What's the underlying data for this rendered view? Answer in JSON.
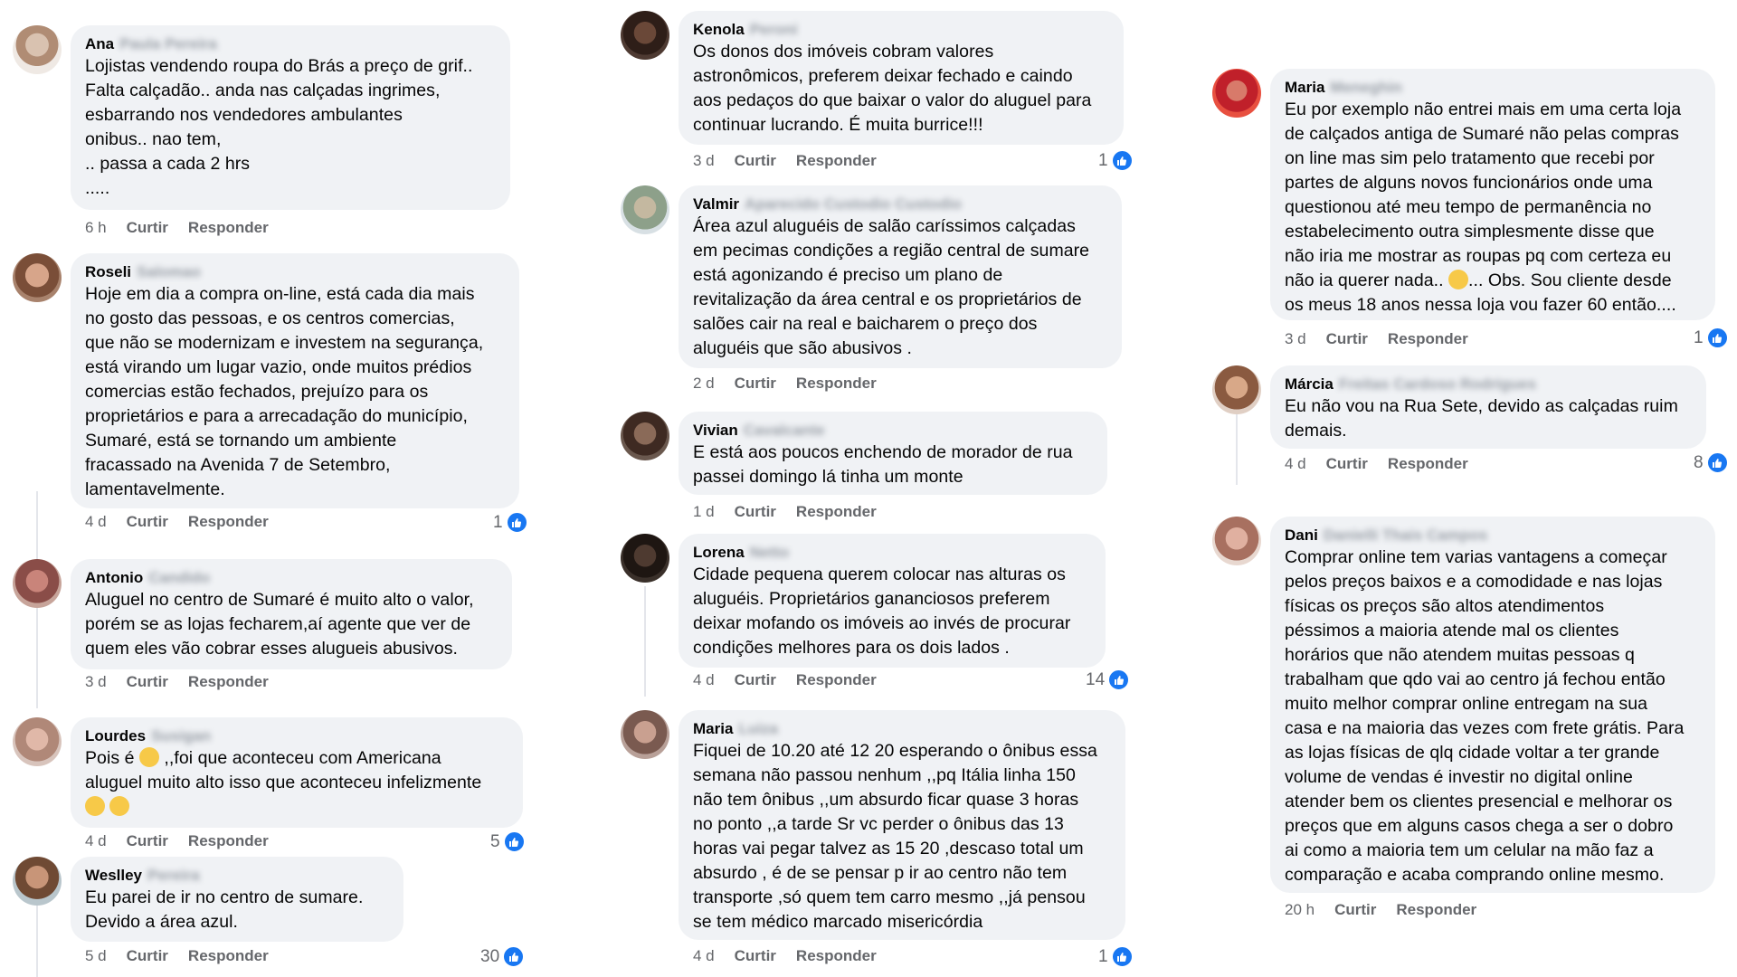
{
  "actions": {
    "like": "Curtir",
    "reply": "Responder"
  },
  "colors": {
    "like_badge": "#1877f2",
    "bubble": "#f0f2f5",
    "meta": "#65676b"
  },
  "columns": [
    [
      {
        "first": "Ana",
        "surname": "Paula Pereira",
        "text": "Lojistas vendendo roupa do Brás a preço de grif..\nFalta calçadão.. anda nas calçadas ingrimes,\nesbarrando nos vendedores ambulantes\nonibus.. nao tem,\n.. passa a cada 2 hrs\n.....",
        "time": "6 h",
        "likes": ""
      },
      {
        "first": "Roseli",
        "surname": "Salomao",
        "text": "Hoje em dia a compra on-line,  está cada dia mais\nno gosto das pessoas, e os centros comercias,\nque não se modernizam e investem na segurança,\nestá virando um lugar vazio, onde muitos prédios\ncomercias estão fechados, prejuízo para os\nproprietários e para a arrecadação do município,\nSumaré,  está se tornando um ambiente\nfracassado na Avenida 7 de Setembro,\nlamentavelmente.",
        "time": "4 d",
        "likes": "1"
      },
      {
        "first": "Antonio",
        "surname": "Candido",
        "text": "Aluguel no centro de Sumaré é muito alto o valor,\nporém se as lojas fecharem,aí agente que ver de\nquem eles vão cobrar esses alugueis abusivos.",
        "time": "3 d",
        "likes": ""
      },
      {
        "first": "Lourdes",
        "surname": "Susigan",
        "text_a": "Pois é ",
        "text_b": " ,,foi que aconteceu com Americana\naluguel muito alto isso que aconteceu infelizmente\n",
        "time": "4 d",
        "likes": "5"
      },
      {
        "first": "Weslley",
        "surname": "Pereira",
        "text": "Eu parei de ir no centro de sumare.\nDevido a área azul.",
        "time": "5 d",
        "likes": "30"
      }
    ],
    [
      {
        "first": "Kenola",
        "surname": "Peroni",
        "text": "Os donos dos imóveis cobram valores\nastronômicos, preferem deixar fechado e caindo\naos pedaços do que baixar o valor do aluguel para\ncontinuar lucrando. É muita burrice!!!",
        "time": "3 d",
        "likes": "1"
      },
      {
        "first": "Valmir",
        "surname": "Aparecido Custodio Custodio",
        "text": "Área azul aluguéis de salão caríssimos calçadas\nem pecimas condições a região central de sumare\nestá agonizando é preciso um plano de\nrevitalização da área central e os proprietários de\nsalões cair na real e baicharem o preço dos\naluguéis que são abusivos .",
        "time": "2 d",
        "likes": ""
      },
      {
        "first": "Vivian",
        "surname": "Cavalcante",
        "text": "E está aos poucos enchendo de morador de rua\npassei domingo lá tinha um monte",
        "time": "1 d",
        "likes": ""
      },
      {
        "first": "Lorena",
        "surname": "Netto",
        "text": "Cidade pequena querem colocar nas alturas os\naluguéis. Proprietários gananciosos preferem\ndeixar mofando os imóveis ao invés de procurar\ncondições melhores para os dois lados .",
        "time": "4 d",
        "likes": "14"
      },
      {
        "first": "Maria",
        "surname": "Luiza",
        "text": "Fiquei de 10.20 até 12 20 esperando o ônibus essa\nsemana não passou nenhum ,,pq Itália linha 150\nnão tem ônibus ,,um absurdo ficar quase 3 horas\nno ponto ,,a tarde Sr vc perder o ônibus das 13\nhoras vai pegar talvez as 15 20 ,descaso total um\nabsurdo , é de se pensar p ir ao centro não tem\ntransporte ,só quem tem carro mesmo ,,já pensou\nse tem médico marcado misericórdia",
        "time": "4 d",
        "likes": "1"
      }
    ],
    [
      {
        "first": "Maria",
        "surname": "Meneghin",
        "text_a": "Eu por exemplo não entrei mais em uma certa loja\nde calçados antiga de Sumaré não pelas compras\non line mas sim pelo tratamento que recebi por\npartes de alguns novos funcionários onde uma\nquestionou até meu tempo de permanência no\nestabelecimento outra simplesmente disse que\nnão iria me mostrar as roupas pq com certeza eu\nnão ia querer nada.. ",
        "text_b": "... Obs. Sou cliente desde\nos meus 18 anos nessa loja vou fazer 60 então....",
        "time": "3 d",
        "likes": "1"
      },
      {
        "first": "Márcia",
        "surname": "Freitas Cardoso Rodrigues",
        "text": "Eu não vou na Rua Sete, devido as calçadas ruim\ndemais.",
        "time": "4 d",
        "likes": "8"
      },
      {
        "first": "Dani",
        "surname": "Danielli Thais Campos",
        "text": "Comprar online tem varias vantagens a começar\npelos preços baixos e a comodidade e nas lojas\nfísicas os preços são altos atendimentos\npéssimos a maioria atende mal os clientes\nhorários que não atendem muitas pessoas q\ntrabalham que qdo vai ao centro já fechou então\nmuito melhor comprar online entregam na sua\ncasa e na maioria das vezes com frete grátis. Para\nas lojas físicas de qlq cidade voltar a ter grande\nvolume de vendas é investir no digital online\natender bem os clientes presencial e melhorar os\npreços que em alguns casos chega a ser o dobro\nai como a maioria tem um celular na mão faz a\ncomparação e acaba comprando online mesmo.",
        "time": "20 h",
        "likes": ""
      }
    ]
  ]
}
